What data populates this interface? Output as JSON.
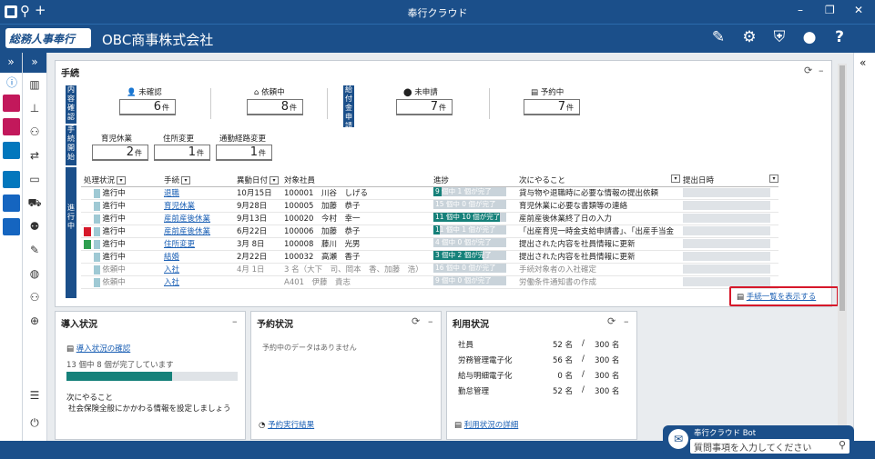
{
  "window": {
    "title": "奉行クラウド"
  },
  "header": {
    "logo_text": "総務人事奉行",
    "company": "OBC商事株式会社"
  },
  "tetsuzuki": {
    "title": "手続",
    "labels": {
      "naiyou": "内容確認",
      "kaishi": "手続開始",
      "kyufu": "給付金申請",
      "shinkou": "進行中"
    },
    "counters": [
      {
        "label": "未確認",
        "value": "6",
        "unit": "件"
      },
      {
        "label": "依頼中",
        "value": "8",
        "unit": "件"
      },
      {
        "label": "未申請",
        "value": "7",
        "unit": "件"
      },
      {
        "label": "予約中",
        "value": "7",
        "unit": "件"
      },
      {
        "label": "育児休業",
        "value": "2",
        "unit": "件"
      },
      {
        "label": "住所変更",
        "value": "1",
        "unit": "件"
      },
      {
        "label": "通勤経路変更",
        "value": "1",
        "unit": "件"
      }
    ],
    "columns": [
      "処理状況",
      "手続",
      "異動日付",
      "対象社員",
      "進捗",
      "次にやること",
      "提出日時"
    ],
    "rows": [
      {
        "status": "進行中",
        "proc": "退職",
        "date": "10月15日",
        "emp": "100001　川谷　しげる",
        "prog": "9 個中 1 個が完了",
        "next": "貸与物や退職時に必要な情報の提出依頼",
        "marker": ""
      },
      {
        "status": "進行中",
        "proc": "育児休業",
        "date": "9月28日",
        "emp": "100005　加藤　恭子",
        "prog": "15 個中 0 個が完了",
        "next": "育児休業に必要な書類等の連絡",
        "marker": ""
      },
      {
        "status": "進行中",
        "proc": "産前産後休業",
        "date": "9月13日",
        "emp": "100020　今村　幸一",
        "prog": "11 個中 10 個が完了",
        "next": "産前産後休業終了日の入力",
        "marker": ""
      },
      {
        "status": "進行中",
        "proc": "産前産後休業",
        "date": "6月22日",
        "emp": "100006　加藤　恭子",
        "prog": "11 個中 1 個が完了",
        "next": "「出産育児一時金支給申請書」、「出産手当金",
        "marker": "red"
      },
      {
        "status": "進行中",
        "proc": "住所変更",
        "date": "3月 8日",
        "emp": "100008　藤川　光男",
        "prog": "4 個中 0 個が完了",
        "next": "提出された内容を社員情報に更新",
        "marker": "green"
      },
      {
        "status": "進行中",
        "proc": "結婚",
        "date": "2月22日",
        "emp": "100032　高瀬　香子",
        "prog": "3 個中 2 個が完了",
        "next": "提出された内容を社員情報に更新",
        "marker": ""
      },
      {
        "status": "依頼中",
        "proc": "入社",
        "date": "4月 1日",
        "emp": "3 名（大下　司、岡本　香、加藤　浩）",
        "prog": "16 個中 0 個が完了",
        "next": "手続対象者の入社確定",
        "marker": ""
      },
      {
        "status": "依頼中",
        "proc": "入社",
        "date": "",
        "emp": "A401　伊藤　貴志",
        "prog": "9 個中 0 個が完了",
        "next": "労働条件通知書の作成",
        "marker": ""
      }
    ],
    "progress_fractions": [
      0.11,
      0.0,
      0.91,
      0.09,
      0.0,
      0.67,
      0.0,
      0.0
    ],
    "list_link": "手続一覧を表示する"
  },
  "intro": {
    "title": "導入状況",
    "link": "導入状況の確認",
    "progress_text": "13 個中 8 個が完了しています",
    "progress_fraction": 0.615,
    "next_label": "次にやること",
    "next_text": "社会保険全般にかかわる情報を設定しましょう"
  },
  "yoyaku": {
    "title": "予約状況",
    "empty": "予約中のデータはありません",
    "link": "予約実行結果"
  },
  "riyou": {
    "title": "利用状況",
    "rows": [
      {
        "label": "社員",
        "used": "52 名",
        "slash": "/",
        "total": "300 名"
      },
      {
        "label": "労務管理電子化",
        "used": "56 名",
        "slash": "/",
        "total": "300 名"
      },
      {
        "label": "給与明細電子化",
        "used": "0 名",
        "slash": "/",
        "total": "300 名"
      },
      {
        "label": "勤怠管理",
        "used": "52 名",
        "slash": "/",
        "total": "300 名"
      }
    ],
    "link": "利用状況の詳細"
  },
  "bot": {
    "title": "奉行クラウド Bot",
    "placeholder": "質問事項を入力してください"
  },
  "colors": {
    "brand": "#1b4f8a",
    "progress": "#16817a",
    "highlight": "#d6182a"
  },
  "icons": [
    "search-icon",
    "plus-icon",
    "notebook-icon",
    "gear-icon",
    "shield-icon",
    "user-icon",
    "help-icon",
    "refresh-icon",
    "collapse-icon"
  ]
}
